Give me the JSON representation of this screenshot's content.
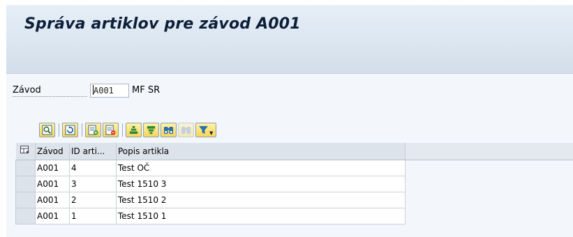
{
  "header": {
    "title": "Správa artiklov pre závod A001"
  },
  "form": {
    "plant_label": "Závod",
    "plant_value": "A001",
    "plant_desc": "MF SR"
  },
  "alv_toolbar": {
    "buttons": [
      "details-icon",
      "refresh-icon",
      "insert-row-icon",
      "delete-row-icon",
      "sort-ascending-icon",
      "sort-descending-icon",
      "find-icon",
      "find-next-icon",
      "filter-icon"
    ]
  },
  "grid": {
    "columns": [
      "Závod",
      "ID arti...",
      "Popis artikla"
    ],
    "rows": [
      {
        "plant": "A001",
        "id": "4",
        "desc": "Test OČ"
      },
      {
        "plant": "A001",
        "id": "3",
        "desc": "Test 1510 3"
      },
      {
        "plant": "A001",
        "id": "2",
        "desc": "Test 1510 2"
      },
      {
        "plant": "A001",
        "id": "1",
        "desc": "Test 1510 1"
      }
    ]
  },
  "colors": {
    "header_bg": "#dbe6f1",
    "toolbar_button": "#f5d55a",
    "grid_header": "#dde3ea"
  }
}
